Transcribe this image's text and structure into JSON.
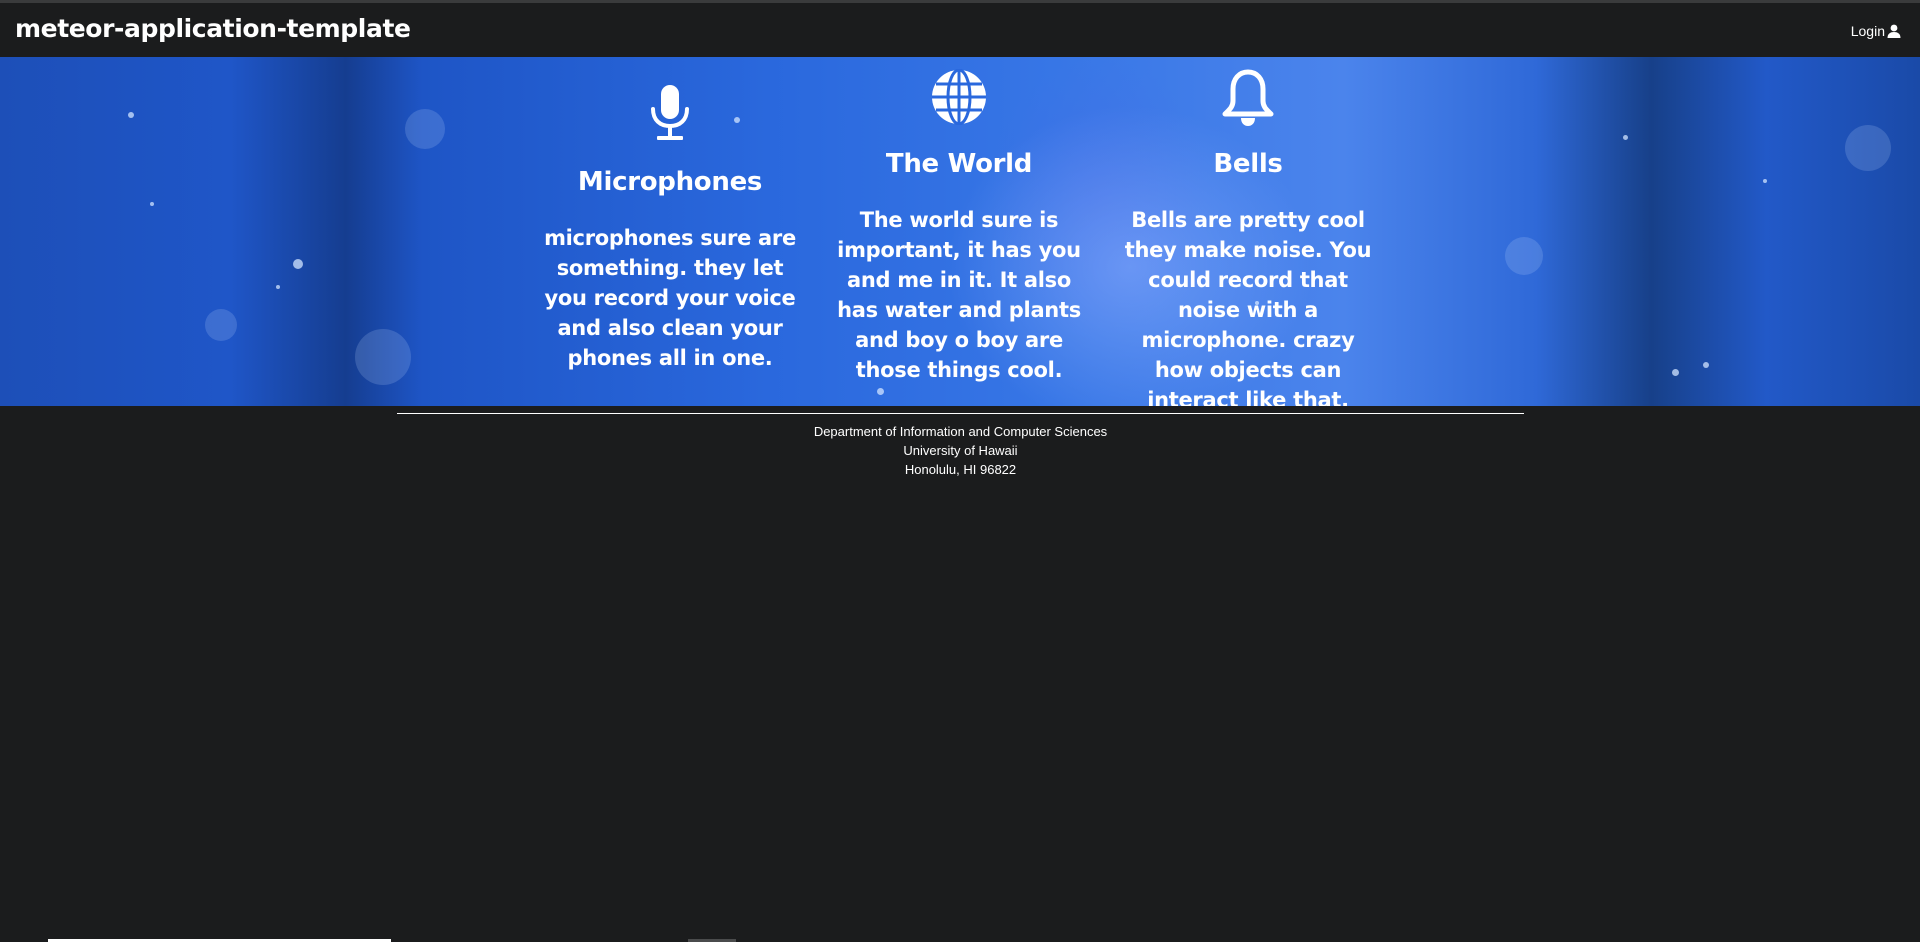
{
  "navbar": {
    "brand": "meteor-application-template",
    "login_label": "Login",
    "login_icon": "user-icon"
  },
  "features": [
    {
      "icon": "microphone-icon",
      "title": "Microphones",
      "text": "microphones sure are something. they let you record your voice and also clean your phones all in one."
    },
    {
      "icon": "globe-icon",
      "title": "The World",
      "text": "The world sure is important, it has you and me in it. It also has water and plants and boy o boy are those things cool."
    },
    {
      "icon": "bell-icon",
      "title": "Bells",
      "text": "Bells are pretty cool they make noise. You could record that noise with a microphone. crazy how objects can interact like that."
    }
  ],
  "footer": {
    "line1": "Department of Information and Computer Sciences",
    "line2": "University of Hawaii",
    "line3": "Honolulu, HI 96822"
  },
  "colors": {
    "background": "#1b1c1d",
    "hero_blue": "#2a68dd",
    "text": "#ffffff"
  }
}
